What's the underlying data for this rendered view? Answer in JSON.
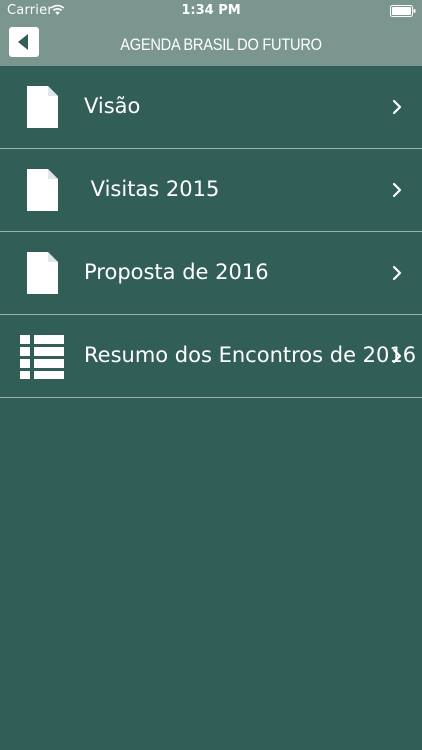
{
  "status_bar": {
    "carrier": "Carrier",
    "time": "1:34 PM",
    "wifi_icon": "wifi-icon",
    "battery_icon": "battery-icon"
  },
  "nav_bar": {
    "title": "AGENDA BRASIL DO FUTURO",
    "back_icon": "back-arrow-icon"
  },
  "menu": {
    "items": [
      {
        "label": "Visão",
        "icon": "document-icon"
      },
      {
        "label": " Visitas 2015",
        "icon": "document-icon"
      },
      {
        "label": "Proposta de 2016",
        "icon": "document-icon"
      },
      {
        "label": "Resumo dos Encontros de 2016",
        "icon": "list-icon"
      }
    ],
    "chevron_icon": "chevron-right-icon"
  },
  "colors": {
    "background": "#315e56",
    "bar": "#7a968f",
    "text": "#ffffff",
    "divider": "#9ab3ad"
  }
}
